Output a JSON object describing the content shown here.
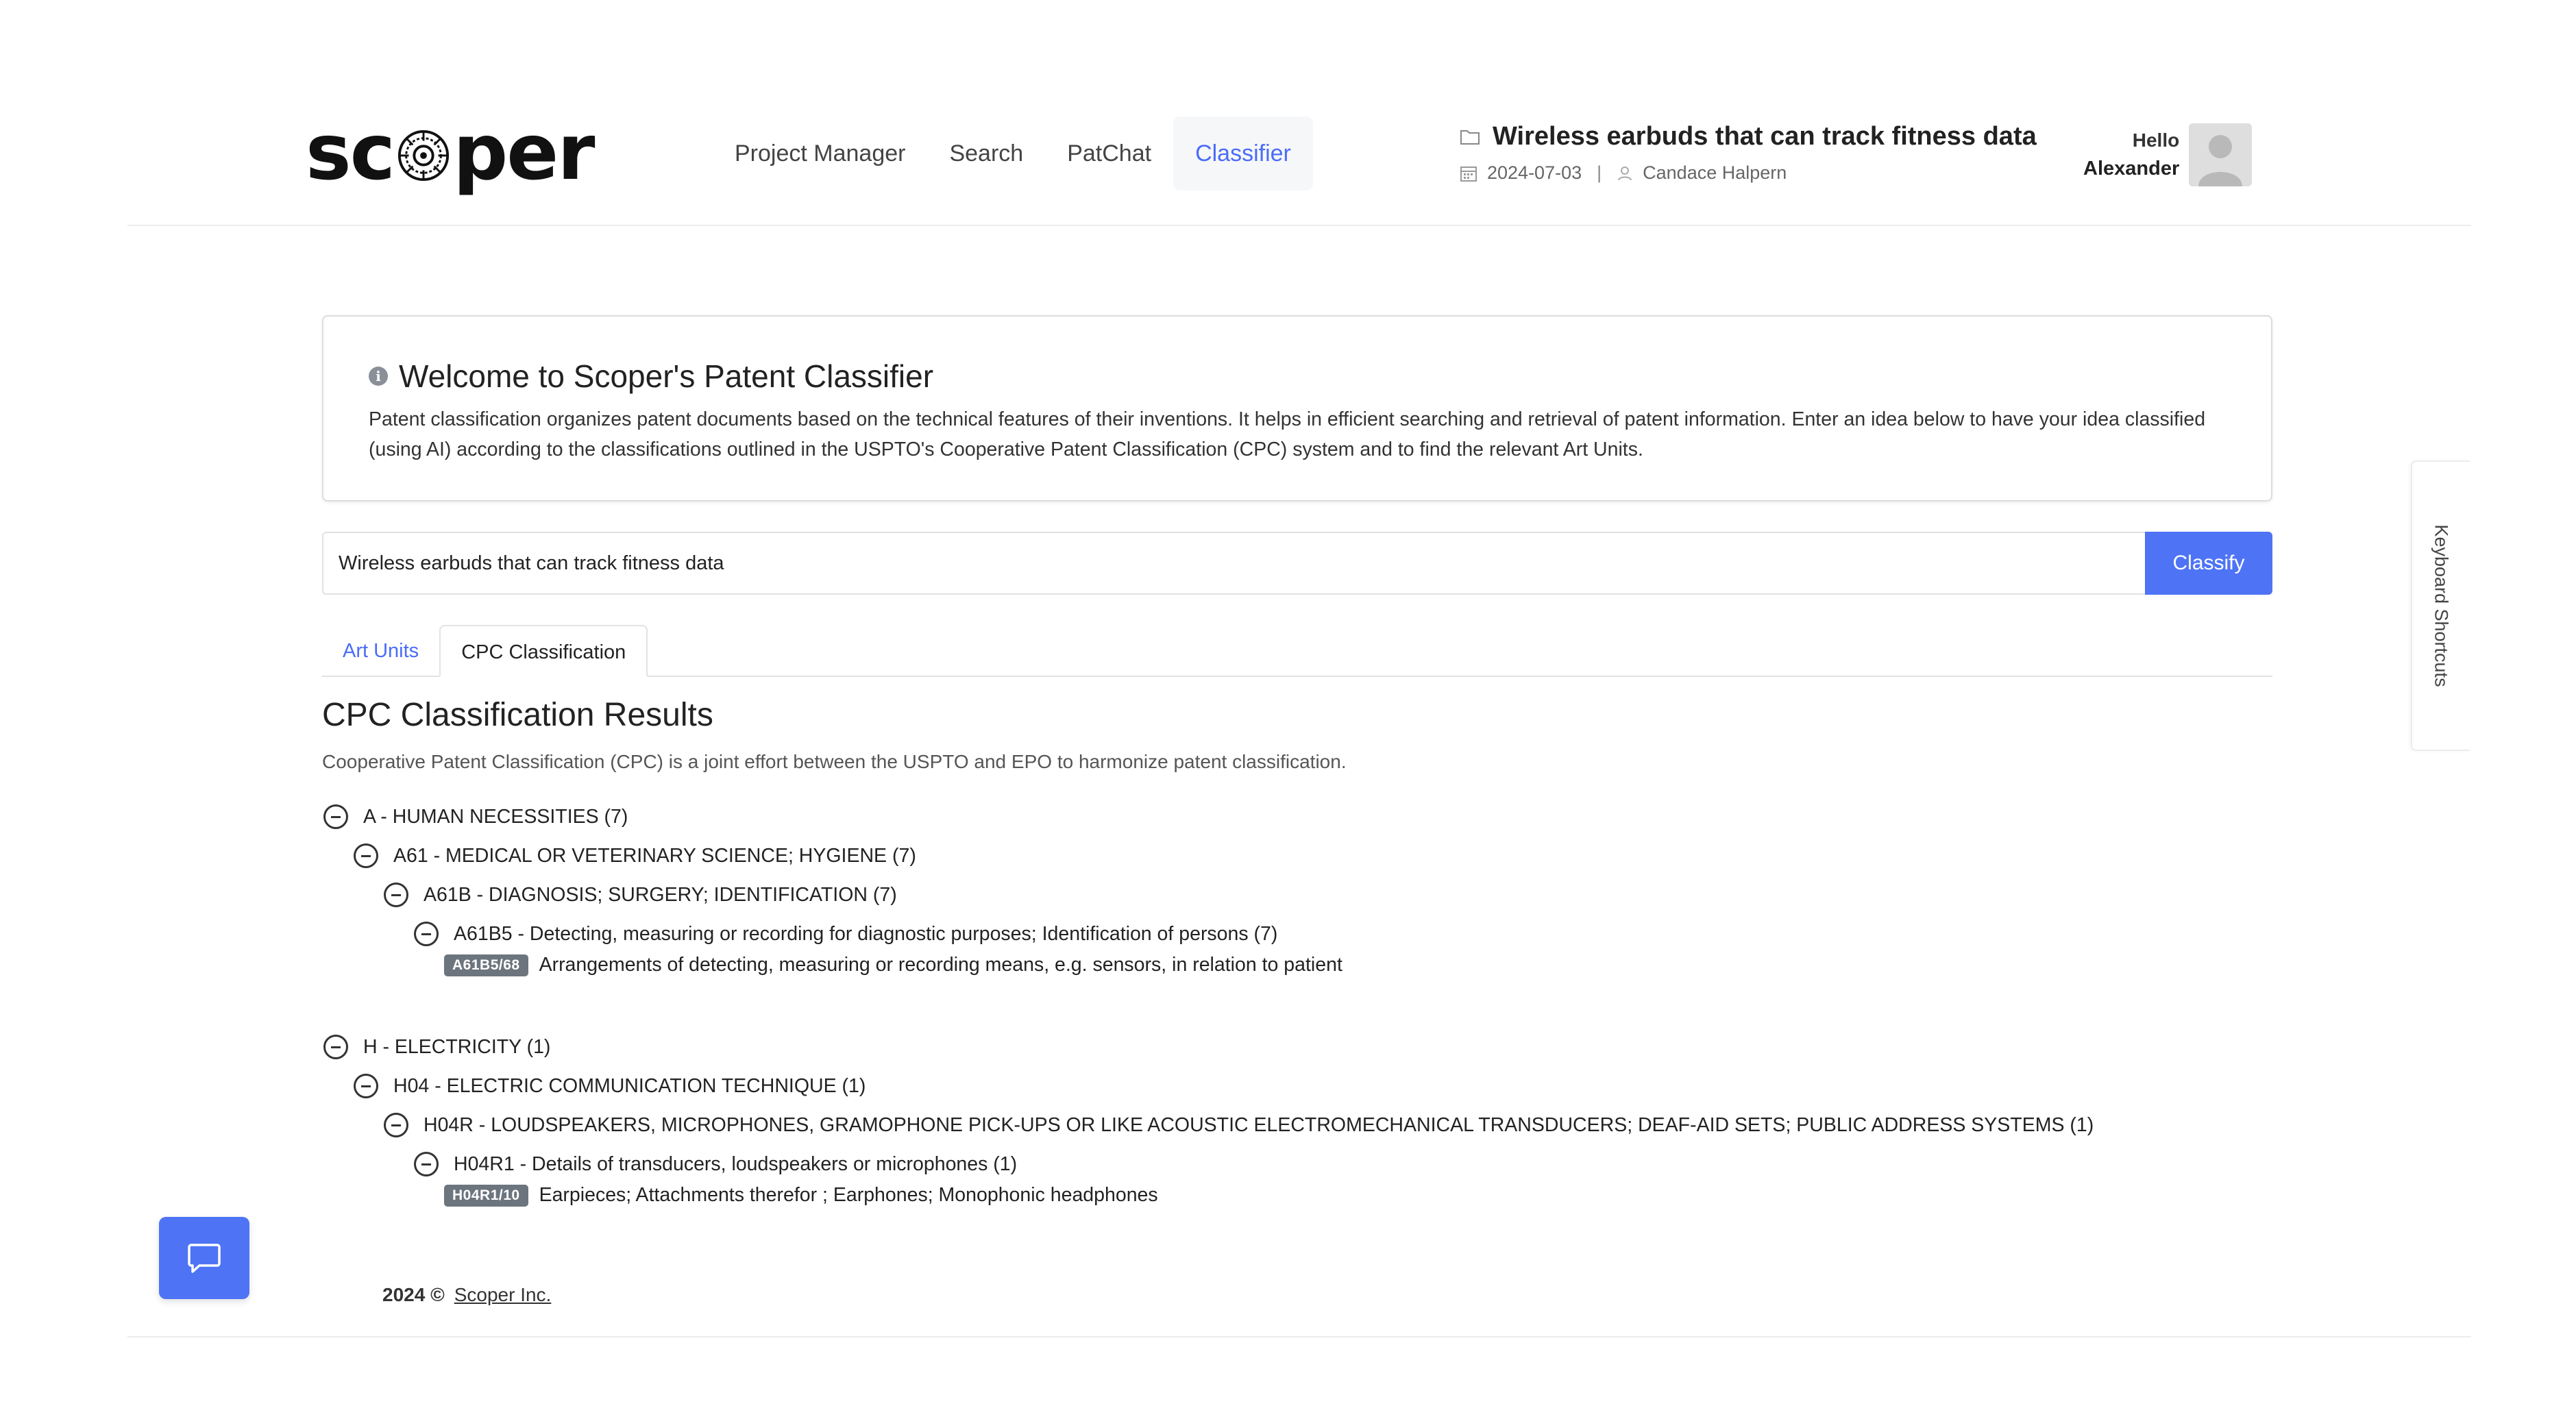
{
  "header": {
    "logo_text_left": "sc",
    "logo_text_right": "per",
    "nav": [
      {
        "label": "Project Manager",
        "active": false
      },
      {
        "label": "Search",
        "active": false
      },
      {
        "label": "PatChat",
        "active": false
      },
      {
        "label": "Classifier",
        "active": true
      }
    ],
    "project": {
      "title": "Wireless earbuds that can track fitness data",
      "date": "2024-07-03",
      "separator": "|",
      "owner": "Candace Halpern",
      "icons": {
        "title": "folder-icon",
        "date": "calendar-icon",
        "owner": "user-icon"
      }
    },
    "user": {
      "greeting": "Hello",
      "name": "Alexander"
    }
  },
  "welcome": {
    "title": "Welcome to Scoper's Patent Classifier",
    "body": "Patent classification organizes patent documents based on the technical features of their inventions. It helps in efficient searching and retrieval of patent information. Enter an idea below to have your idea classified (using AI) according to the classifications outlined in the USPTO's Cooperative Patent Classification (CPC) system and to find the relevant Art Units."
  },
  "classify": {
    "input_value": "Wireless earbuds that can track fitness data",
    "button_label": "Classify"
  },
  "tabs": [
    {
      "label": "Art Units",
      "active": false
    },
    {
      "label": "CPC Classification",
      "active": true
    }
  ],
  "results": {
    "title": "CPC Classification Results",
    "subtitle": "Cooperative Patent Classification (CPC) is a joint effort between the USPTO and EPO to harmonize patent classification.",
    "tree": [
      {
        "section": "A - HUMAN NECESSITIES (7)",
        "class": "A61 - MEDICAL OR VETERINARY SCIENCE; HYGIENE (7)",
        "subclass": "A61B - DIAGNOSIS; SURGERY; IDENTIFICATION (7)",
        "group": "A61B5 - Detecting, measuring or recording for diagnostic purposes; Identification of persons (7)",
        "leaf_code": "A61B5/68",
        "leaf_text": "Arrangements of detecting, measuring or recording means, e.g. sensors, in relation to patient"
      },
      {
        "section": "H - ELECTRICITY (1)",
        "class": "H04 - ELECTRIC COMMUNICATION TECHNIQUE (1)",
        "subclass": "H04R - LOUDSPEAKERS, MICROPHONES, GRAMOPHONE PICK-UPS OR LIKE ACOUSTIC ELECTROMECHANICAL TRANSDUCERS; DEAF-AID SETS; PUBLIC ADDRESS SYSTEMS (1)",
        "group": "H04R1 - Details of transducers, loudspeakers or microphones (1)",
        "leaf_code": "H04R1/10",
        "leaf_text": "Earpieces; Attachments therefor ; Earphones; Monophonic headphones"
      }
    ]
  },
  "footer": {
    "year": "2024 ©",
    "company": "Scoper Inc."
  },
  "side": {
    "keyboard_shortcuts": "Keyboard Shortcuts"
  },
  "colors": {
    "accent": "#4e74f5",
    "badge": "#6c757d"
  }
}
